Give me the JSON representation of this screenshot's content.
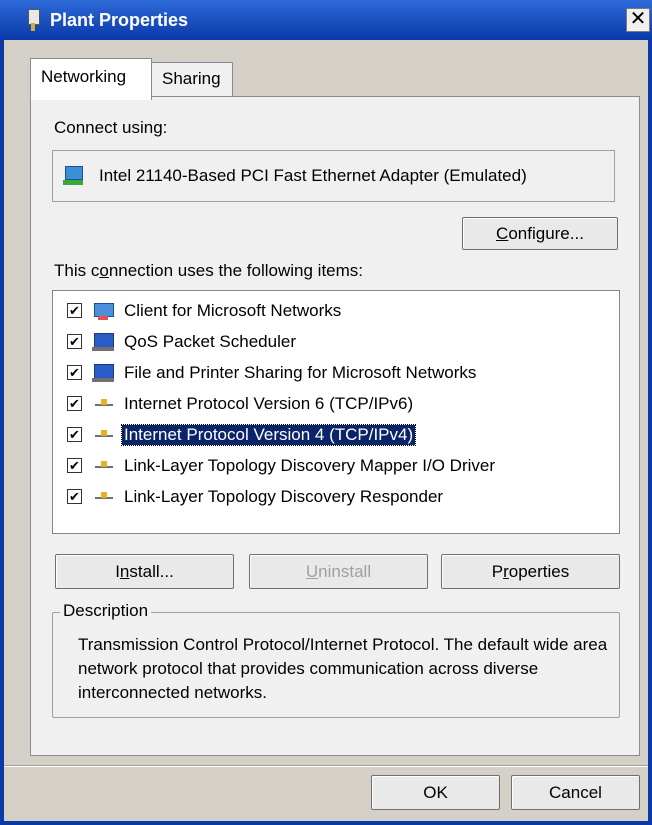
{
  "window": {
    "title": "Plant Properties",
    "close_glyph": "✕"
  },
  "tabs": [
    {
      "label": "Networking",
      "active": true
    },
    {
      "label": "Sharing",
      "active": false
    }
  ],
  "connect_using": {
    "label": "Connect using:",
    "adapter": "Intel 21140-Based PCI Fast Ethernet Adapter (Emulated)"
  },
  "buttons": {
    "configure": {
      "pre": "",
      "u": "C",
      "post": "onfigure..."
    },
    "install": {
      "pre": "I",
      "u": "n",
      "post": "stall..."
    },
    "uninstall": {
      "pre": "",
      "u": "U",
      "post": "ninstall"
    },
    "properties": {
      "pre": "P",
      "u": "r",
      "post": "operties"
    },
    "ok": "OK",
    "cancel": "Cancel"
  },
  "items_label": {
    "pre": "This c",
    "u": "o",
    "post": "nnection uses the following items:"
  },
  "items": [
    {
      "label": "Client for Microsoft Networks",
      "checked": true,
      "icon": "network-client-icon"
    },
    {
      "label": "QoS Packet Scheduler",
      "checked": true,
      "icon": "computer-icon"
    },
    {
      "label": "File and Printer Sharing for Microsoft Networks",
      "checked": true,
      "icon": "computer-icon"
    },
    {
      "label": "Internet Protocol Version 6 (TCP/IPv6)",
      "checked": true,
      "icon": "protocol-icon"
    },
    {
      "label": "Internet Protocol Version 4 (TCP/IPv4)",
      "checked": true,
      "icon": "protocol-icon",
      "selected": true
    },
    {
      "label": "Link-Layer Topology Discovery Mapper I/O Driver",
      "checked": true,
      "icon": "protocol-icon"
    },
    {
      "label": "Link-Layer Topology Discovery Responder",
      "checked": true,
      "icon": "protocol-icon"
    }
  ],
  "description": {
    "legend": "Description",
    "text": "Transmission Control Protocol/Internet Protocol. The default wide area network protocol that provides communication across diverse interconnected networks."
  },
  "colors": {
    "titlebar": "#0a39a8",
    "selection": "#0a246a",
    "face": "#f0f0f0"
  }
}
